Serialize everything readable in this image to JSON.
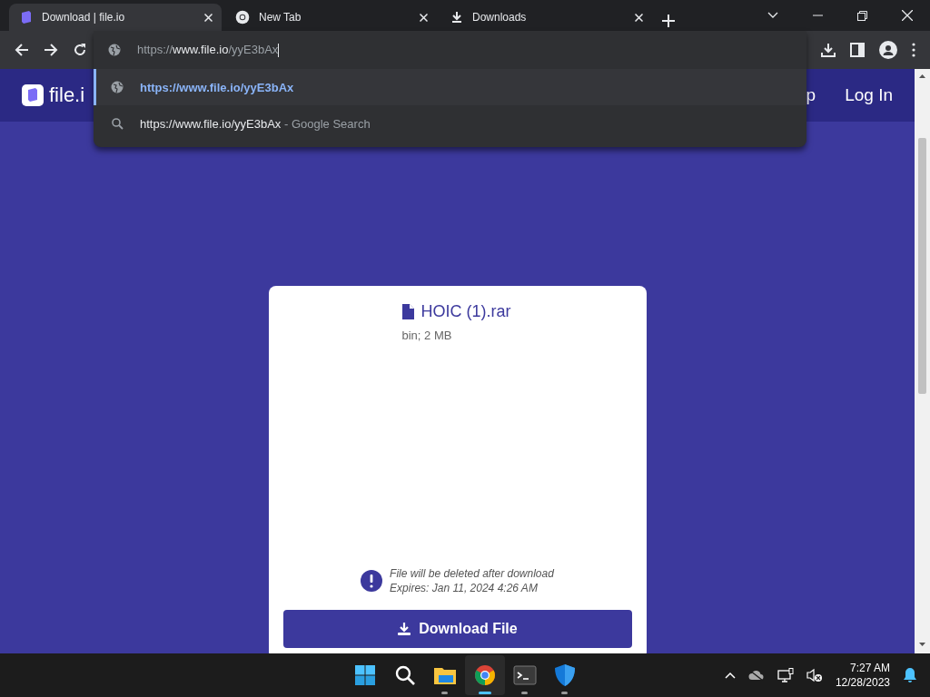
{
  "tabs": [
    {
      "title": "Download | file.io",
      "kind": "fileio",
      "selected": true
    },
    {
      "title": "New Tab",
      "kind": "chrome",
      "selected": false
    },
    {
      "title": "Downloads",
      "kind": "download",
      "selected": false
    }
  ],
  "omnibox": {
    "scheme": "https://",
    "host": "www.file.io",
    "path": "/yyE3bAx"
  },
  "suggestions": [
    {
      "kind": "url",
      "text": "https://www.file.io/yyE3bAx",
      "selected": true
    },
    {
      "kind": "search",
      "text": "https://www.file.io/yyE3bAx",
      "suffix": "- Google Search",
      "selected": false
    }
  ],
  "site": {
    "logo_text": "file.i",
    "nav": [
      "p",
      "Log In"
    ]
  },
  "file": {
    "name": "HOIC (1).rar",
    "meta": "bin; 2 MB",
    "notice": [
      "File will be deleted after download",
      "Expires: Jan 11, 2024 4:26 AM"
    ],
    "button": "Download File"
  },
  "taskbar": {
    "apps": [
      {
        "kind": "start",
        "running": false,
        "selected": false
      },
      {
        "kind": "search",
        "running": false,
        "selected": false
      },
      {
        "kind": "explorer",
        "running": true,
        "selected": false
      },
      {
        "kind": "chrome",
        "running": true,
        "selected": true
      },
      {
        "kind": "terminal",
        "running": true,
        "selected": false
      },
      {
        "kind": "defender",
        "running": true,
        "selected": false
      }
    ],
    "time": "7:27 AM",
    "date": "12/28/2023"
  }
}
